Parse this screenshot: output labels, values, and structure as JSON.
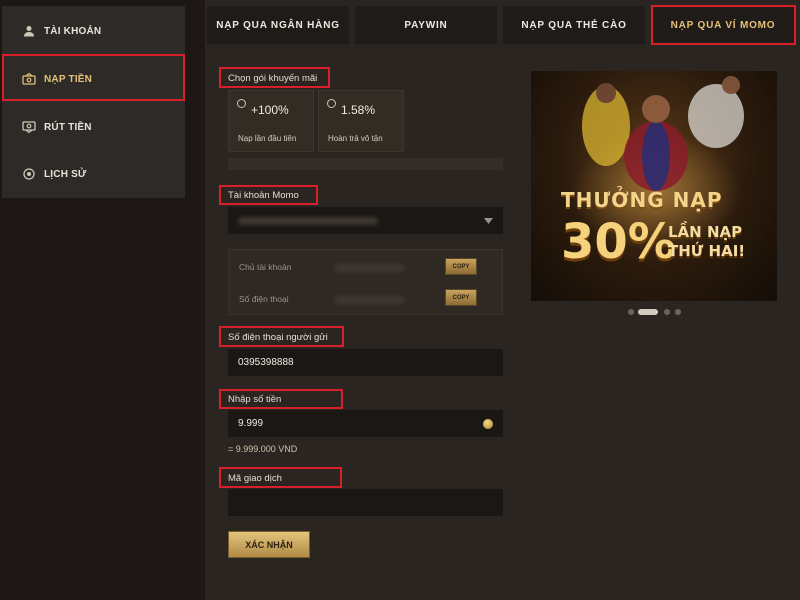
{
  "sidebar": {
    "items": [
      {
        "label": "TÀI KHOẢN",
        "icon": "user-icon"
      },
      {
        "label": "NẠP TIỀN",
        "icon": "deposit-icon",
        "active": true
      },
      {
        "label": "RÚT TIỀN",
        "icon": "withdraw-icon"
      },
      {
        "label": "LỊCH SỬ",
        "icon": "history-icon"
      }
    ]
  },
  "tabs": [
    {
      "label": "NẠP QUA NGÂN HÀNG"
    },
    {
      "label": "PAYWIN"
    },
    {
      "label": "NẠP QUA THẺ CÀO"
    },
    {
      "label": "NẠP QUA VÍ MOMO",
      "active": true
    }
  ],
  "form": {
    "promo_label": "Chọn gói khuyến mãi",
    "promos": [
      {
        "value": "+100%",
        "desc": "Nạp lần đầu tiên"
      },
      {
        "value": "1.58%",
        "desc": "Hoàn trả vô tận"
      }
    ],
    "momo_account_label": "Tài khoản Momo",
    "owner_label": "Chủ tài khoản",
    "phone_label": "Số điện thoại",
    "copy_label": "COPY",
    "sender_phone_label": "Số điện thoại người gửi",
    "sender_phone_value": "0395398888",
    "amount_label": "Nhập số tiền",
    "amount_value": "9.999",
    "amount_converted": "= 9.999.000 VND",
    "transaction_code_label": "Mã giao dịch",
    "transaction_code_value": "",
    "submit_label": "XÁC NHẬN"
  },
  "banner": {
    "line1": "THƯỞNG NẠP",
    "line2": "30%",
    "line3a": "LẦN NẠP",
    "line3b": "THỨ HAI!"
  },
  "carousel": {
    "count": 4,
    "active_index": 1
  },
  "colors": {
    "accent": "#e6c27a",
    "highlight": "#d9202a",
    "background": "#2a2521"
  }
}
